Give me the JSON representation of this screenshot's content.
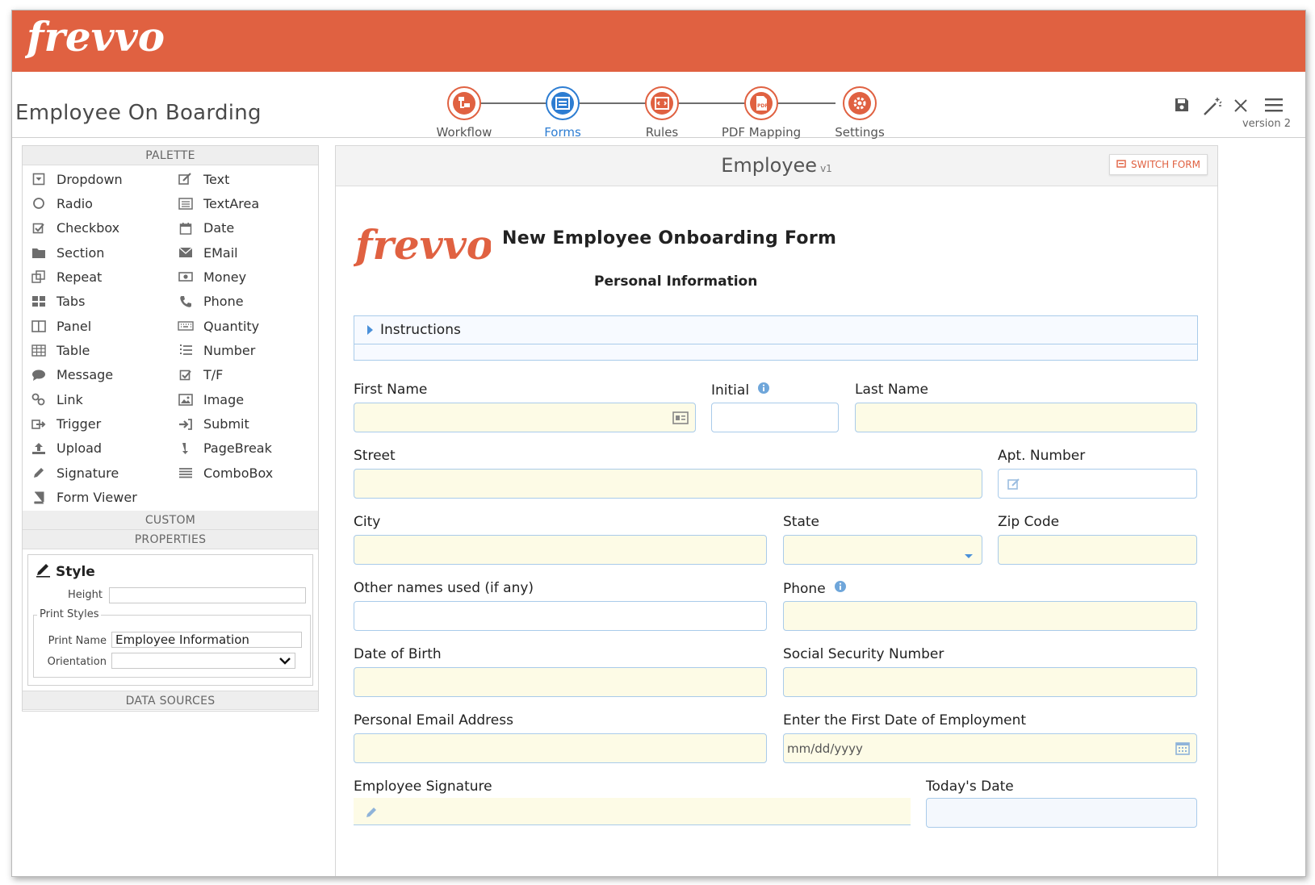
{
  "app": {
    "brand": "frevvo",
    "title": "Employee On Boarding",
    "version": "version 2",
    "accent": "#e06141",
    "active_color": "#2d7dd2"
  },
  "steps": [
    {
      "label": "Workflow",
      "icon": "workflow-icon",
      "active": false
    },
    {
      "label": "Forms",
      "icon": "forms-icon",
      "active": true
    },
    {
      "label": "Rules",
      "icon": "rules-icon",
      "active": false
    },
    {
      "label": "PDF Mapping",
      "icon": "pdf-icon",
      "active": false
    },
    {
      "label": "Settings",
      "icon": "gear-icon",
      "active": false
    }
  ],
  "toolbar": [
    "save-icon",
    "magic-wand-icon",
    "close-icon",
    "menu-icon"
  ],
  "palette": {
    "heading": "PALETTE",
    "left": [
      {
        "label": "Dropdown",
        "icon": "dropdown-icon"
      },
      {
        "label": "Radio",
        "icon": "radio-icon"
      },
      {
        "label": "Checkbox",
        "icon": "checkbox-icon"
      },
      {
        "label": "Section",
        "icon": "folder-icon"
      },
      {
        "label": "Repeat",
        "icon": "repeat-icon"
      },
      {
        "label": "Tabs",
        "icon": "tabs-icon"
      },
      {
        "label": "Panel",
        "icon": "panel-icon"
      },
      {
        "label": "Table",
        "icon": "table-icon"
      },
      {
        "label": "Message",
        "icon": "message-icon"
      },
      {
        "label": "Link",
        "icon": "link-icon"
      },
      {
        "label": "Trigger",
        "icon": "trigger-icon"
      },
      {
        "label": "Upload",
        "icon": "upload-icon"
      },
      {
        "label": "Signature",
        "icon": "pencil-icon"
      },
      {
        "label": "Form Viewer",
        "icon": "book-icon"
      }
    ],
    "right": [
      {
        "label": "Text",
        "icon": "edit-icon"
      },
      {
        "label": "TextArea",
        "icon": "textarea-icon"
      },
      {
        "label": "Date",
        "icon": "calendar-icon"
      },
      {
        "label": "EMail",
        "icon": "envelope-icon"
      },
      {
        "label": "Money",
        "icon": "money-icon"
      },
      {
        "label": "Phone",
        "icon": "phone-icon"
      },
      {
        "label": "Quantity",
        "icon": "keyboard-icon"
      },
      {
        "label": "Number",
        "icon": "list-ol-icon"
      },
      {
        "label": "T/F",
        "icon": "checkbox-icon"
      },
      {
        "label": "Image",
        "icon": "image-icon"
      },
      {
        "label": "Submit",
        "icon": "submit-icon"
      },
      {
        "label": "PageBreak",
        "icon": "pagebreak-icon"
      },
      {
        "label": "ComboBox",
        "icon": "combobox-icon"
      }
    ],
    "custom_heading": "CUSTOM",
    "properties_heading": "PROPERTIES",
    "data_sources_heading": "DATA SOURCES"
  },
  "properties": {
    "style_title": "Style",
    "height_label": "Height",
    "height_value": "",
    "print_styles_legend": "Print Styles",
    "print_name_label": "Print Name",
    "print_name_value": "Employee Information",
    "orientation_label": "Orientation",
    "orientation_value": ""
  },
  "canvas": {
    "form_name": "Employee",
    "form_version": "v1",
    "switch_form": "SWITCH FORM",
    "heading": "New Employee Onboarding Form",
    "subheading": "Personal Information",
    "instructions": "Instructions"
  },
  "fields": {
    "first_name": "First Name",
    "initial": "Initial",
    "last_name": "Last Name",
    "street": "Street",
    "apt": "Apt. Number",
    "city": "City",
    "state": "State",
    "zip": "Zip Code",
    "other_names": "Other names used (if any)",
    "phone": "Phone",
    "dob": "Date of Birth",
    "ssn": "Social Security Number",
    "email": "Personal Email Address",
    "start_date": "Enter the First Date of Employment",
    "start_date_placeholder": "mm/dd/yyyy",
    "signature": "Employee Signature",
    "todays_date": "Today's Date"
  }
}
